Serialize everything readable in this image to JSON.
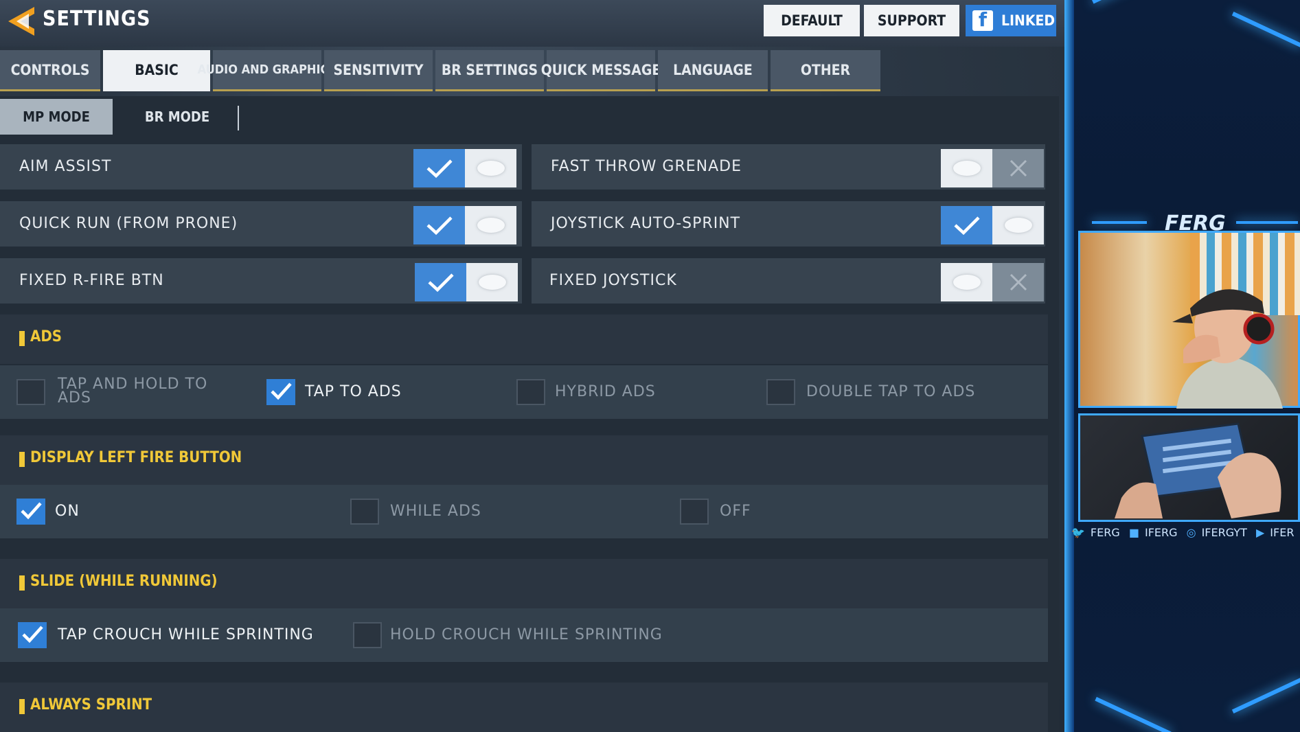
{
  "header": {
    "title": "SETTINGS"
  },
  "top_buttons": {
    "default": "DEFAULT",
    "support": "SUPPORT",
    "linked": "LINKED"
  },
  "tabs": [
    {
      "label": "CONTROLS",
      "active": false
    },
    {
      "label": "BASIC",
      "active": true
    },
    {
      "label": "AUDIO AND GRAPHICS",
      "active": false
    },
    {
      "label": "SENSITIVITY",
      "active": false
    },
    {
      "label": "BR SETTINGS",
      "active": false
    },
    {
      "label": "QUICK MESSAGE",
      "active": false
    },
    {
      "label": "LANGUAGE",
      "active": false
    },
    {
      "label": "OTHER",
      "active": false
    }
  ],
  "mode_tabs": {
    "mp": "MP MODE",
    "br": "BR MODE"
  },
  "toggles": [
    {
      "label": "AIM ASSIST",
      "on": true
    },
    {
      "label": "FAST THROW GRENADE",
      "on": false
    },
    {
      "label": "QUICK RUN (FROM PRONE)",
      "on": true
    },
    {
      "label": "JOYSTICK AUTO-SPRINT",
      "on": true
    },
    {
      "label": "FIXED R-FIRE BTN",
      "on": true
    },
    {
      "label": "FIXED JOYSTICK",
      "on": false
    }
  ],
  "sections": {
    "ads": {
      "title": "ADS",
      "options": [
        {
          "label": "TAP AND HOLD TO ADS",
          "checked": false
        },
        {
          "label": "TAP TO ADS",
          "checked": true
        },
        {
          "label": "HYBRID ADS",
          "checked": false
        },
        {
          "label": "DOUBLE TAP TO ADS",
          "checked": false
        }
      ]
    },
    "left_fire": {
      "title": "DISPLAY LEFT FIRE BUTTON",
      "options": [
        {
          "label": "ON",
          "checked": true
        },
        {
          "label": "WHILE ADS",
          "checked": false
        },
        {
          "label": "OFF",
          "checked": false
        }
      ]
    },
    "slide": {
      "title": "SLIDE (WHILE RUNNING)",
      "options": [
        {
          "label": "TAP CROUCH WHILE SPRINTING",
          "checked": true
        },
        {
          "label": "HOLD CROUCH WHILE SPRINTING",
          "checked": false
        }
      ]
    },
    "always_sprint": {
      "title": "ALWAYS SPRINT"
    }
  },
  "overlay": {
    "streamer_name": "FERG",
    "handles": [
      {
        "icon": "twitter-icon",
        "text": "FERG"
      },
      {
        "icon": "facebook-icon",
        "text": "IFERG"
      },
      {
        "icon": "instagram-icon",
        "text": "IFERGYT"
      },
      {
        "icon": "youtube-icon",
        "text": "IFER"
      }
    ]
  },
  "colors": {
    "accent_yellow": "#f0c838",
    "toggle_on_blue": "#3f87d6",
    "active_tab": "#eef1f4",
    "overlay_glow": "#3fb0ff"
  }
}
